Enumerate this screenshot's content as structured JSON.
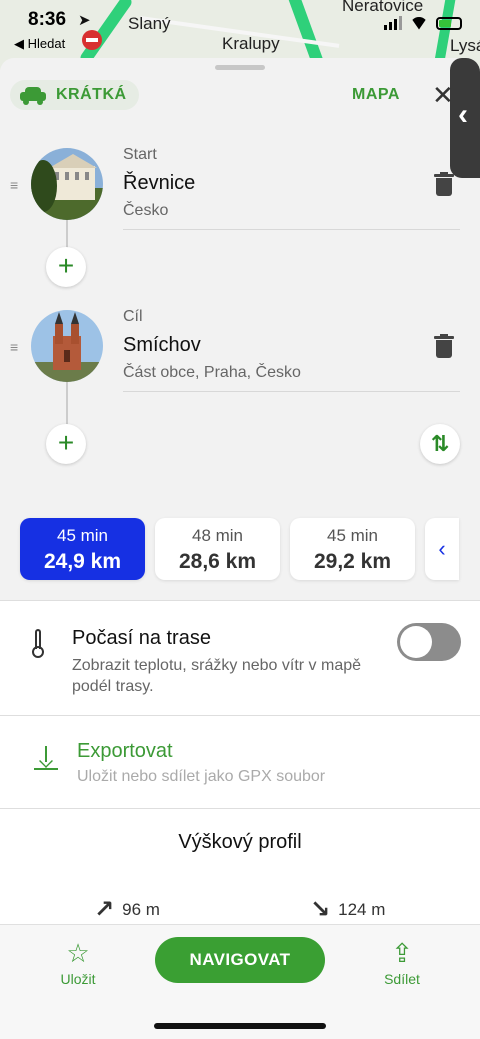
{
  "status": {
    "time": "8:36",
    "back_label": "◀ Hledat"
  },
  "map": {
    "towns": [
      "Slaný",
      "Kralupy",
      "Neratovice",
      "Lysá"
    ]
  },
  "header": {
    "mode_label": "KRÁTKÁ",
    "map_label": "MAPA",
    "close_glyph": "✕"
  },
  "waypoints": [
    {
      "role": "Start",
      "name": "Řevnice",
      "subtitle": "Česko"
    },
    {
      "role": "Cíl",
      "name": "Smíchov",
      "subtitle": "Část obce, Praha, Česko"
    }
  ],
  "add_glyph": "+",
  "routes": [
    {
      "time": "45 min",
      "distance": "24,9 km",
      "selected": true
    },
    {
      "time": "48 min",
      "distance": "28,6 km",
      "selected": false
    },
    {
      "time": "45 min",
      "distance": "29,2 km",
      "selected": false
    }
  ],
  "weather": {
    "title": "Počasí na trase",
    "description": "Zobrazit teplotu, srážky nebo vítr v mapě podél trasy.",
    "enabled": false
  },
  "export": {
    "title": "Exportovat",
    "description": "Uložit nebo sdílet jako GPX soubor"
  },
  "elevation": {
    "title": "Výškový profil",
    "ascent": "96 m",
    "descent": "124 m"
  },
  "bottom_bar": {
    "save_label": "Uložit",
    "navigate_label": "NAVIGOVAT",
    "share_label": "Sdílet"
  },
  "colors": {
    "accent_green": "#3c9a36",
    "selected_route_blue": "#1630e3"
  }
}
